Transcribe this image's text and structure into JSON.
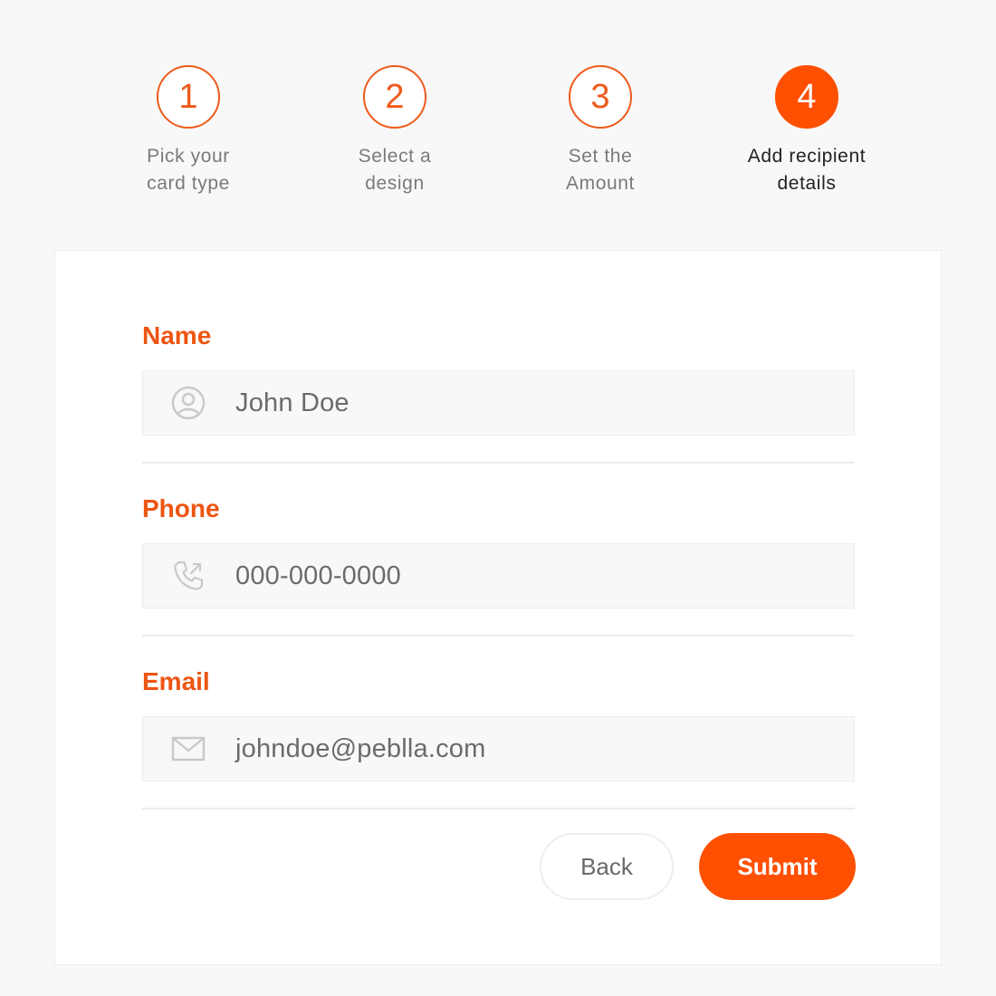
{
  "stepper": {
    "steps": [
      {
        "number": "1",
        "line1": "Pick your",
        "line2": "card type"
      },
      {
        "number": "2",
        "line1": "Select a",
        "line2": "design"
      },
      {
        "number": "3",
        "line1": "Set the",
        "line2": "Amount"
      },
      {
        "number": "4",
        "line1": "Add recipient",
        "line2": "details"
      }
    ],
    "active_step": 4
  },
  "form": {
    "name": {
      "label": "Name",
      "value": "John Doe",
      "icon": "user-circle-icon"
    },
    "phone": {
      "label": "Phone",
      "value": "000-000-0000",
      "icon": "phone-outgoing-icon"
    },
    "email": {
      "label": "Email",
      "value": "johndoe@peblla.com",
      "icon": "mail-icon"
    }
  },
  "buttons": {
    "back_label": "Back",
    "submit_label": "Submit"
  },
  "colors": {
    "accent": "#fe5000",
    "label_orange": "#ec5512",
    "page_bg": "#f8f8f8",
    "input_bg": "#f8f8f8"
  }
}
